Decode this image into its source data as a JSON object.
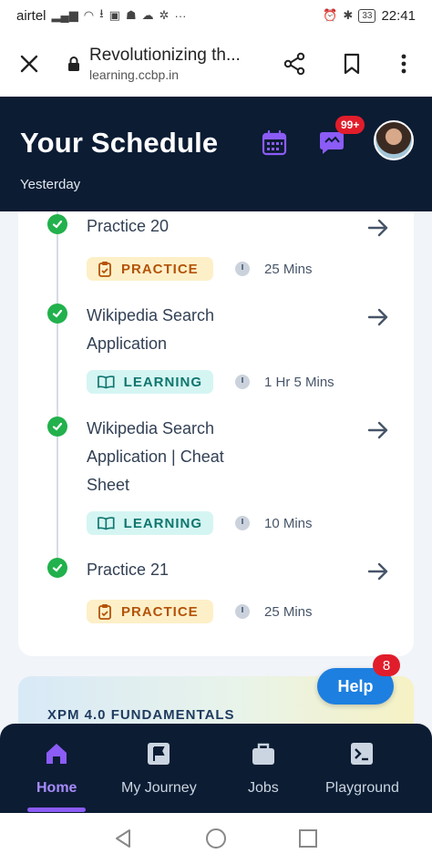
{
  "status_bar": {
    "carrier": "airtel",
    "battery": "33",
    "time": "22:41"
  },
  "browser": {
    "page_title": "Revolutionizing th...",
    "url": "learning.ccbp.in"
  },
  "header": {
    "title": "Your Schedule",
    "subtitle": "Yesterday",
    "notification_badge": "99+"
  },
  "schedule": {
    "items": [
      {
        "title": "Practice 20",
        "tag": "PRACTICE",
        "duration": "25 Mins"
      },
      {
        "title_lines": [
          "Wikipedia Search",
          "Application"
        ],
        "tag": "LEARNING",
        "duration": "1 Hr 5 Mins"
      },
      {
        "title_lines": [
          "Wikipedia Search",
          "Application | Cheat",
          "Sheet"
        ],
        "tag": "LEARNING",
        "duration": "10 Mins"
      },
      {
        "title": "Practice 21",
        "tag": "PRACTICE",
        "duration": "25 Mins"
      }
    ]
  },
  "xpm_card": {
    "title": "XPM 4.0 FUNDAMENTALS"
  },
  "help": {
    "label": "Help",
    "badge": "8"
  },
  "bottom_nav": {
    "items": [
      {
        "label": "Home",
        "icon": "home-icon",
        "active": true
      },
      {
        "label": "My Journey",
        "icon": "flag-icon",
        "active": false
      },
      {
        "label": "Jobs",
        "icon": "briefcase-icon",
        "active": false
      },
      {
        "label": "Playground",
        "icon": "terminal-icon",
        "active": false
      }
    ]
  },
  "colors": {
    "header_bg": "#0b1c33",
    "accent_purple": "#8b5cf6",
    "check_green": "#22b14c",
    "help_blue": "#1d7fe0",
    "badge_red": "#e11d2b"
  }
}
